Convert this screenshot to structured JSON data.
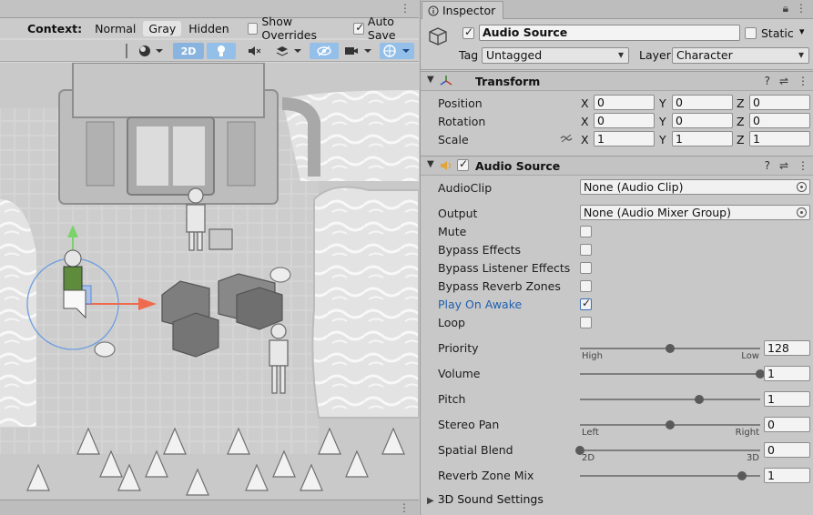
{
  "scene": {
    "context_label": "Context:",
    "context_options": [
      "Normal",
      "Gray",
      "Hidden"
    ],
    "context_selected": "Gray",
    "show_overrides_label": "Show Overrides",
    "show_overrides_checked": false,
    "auto_save_label": "Auto Save",
    "auto_save_checked": true,
    "toolbar": {
      "mode_2d_label": "2D"
    }
  },
  "inspector": {
    "tab_label": "Inspector",
    "object": {
      "active": true,
      "name": "Audio Source",
      "static_label": "Static",
      "static_checked": false,
      "tag_label": "Tag",
      "tag_value": "Untagged",
      "layer_label": "Layer",
      "layer_value": "Character"
    },
    "transform": {
      "title": "Transform",
      "rows": [
        {
          "label": "Position",
          "x": "0",
          "y": "0",
          "z": "0"
        },
        {
          "label": "Rotation",
          "x": "0",
          "y": "0",
          "z": "0"
        },
        {
          "label": "Scale",
          "x": "1",
          "y": "1",
          "z": "1"
        }
      ],
      "axis_x": "X",
      "axis_y": "Y",
      "axis_z": "Z"
    },
    "audio_source": {
      "title": "Audio Source",
      "enabled": true,
      "audioclip_label": "AudioClip",
      "audioclip_value": "None (Audio Clip)",
      "output_label": "Output",
      "output_value": "None (Audio Mixer Group)",
      "toggles": [
        {
          "label": "Mute",
          "checked": false
        },
        {
          "label": "Bypass Effects",
          "checked": false
        },
        {
          "label": "Bypass Listener Effects",
          "checked": false
        },
        {
          "label": "Bypass Reverb Zones",
          "checked": false
        },
        {
          "label": "Play On Awake",
          "checked": true
        },
        {
          "label": "Loop",
          "checked": false
        }
      ],
      "sliders": [
        {
          "label": "Priority",
          "value": "128",
          "fraction": 0.5,
          "left_sub": "High",
          "right_sub": "Low"
        },
        {
          "label": "Volume",
          "value": "1",
          "fraction": 1.0,
          "left_sub": "",
          "right_sub": ""
        },
        {
          "label": "Pitch",
          "value": "1",
          "fraction": 0.66,
          "left_sub": "",
          "right_sub": ""
        },
        {
          "label": "Stereo Pan",
          "value": "0",
          "fraction": 0.5,
          "left_sub": "Left",
          "right_sub": "Right"
        },
        {
          "label": "Spatial Blend",
          "value": "0",
          "fraction": 0.0,
          "left_sub": "2D",
          "right_sub": "3D"
        },
        {
          "label": "Reverb Zone Mix",
          "value": "1",
          "fraction": 0.9,
          "left_sub": "",
          "right_sub": ""
        }
      ],
      "sound3d_label": "3D Sound Settings"
    }
  }
}
